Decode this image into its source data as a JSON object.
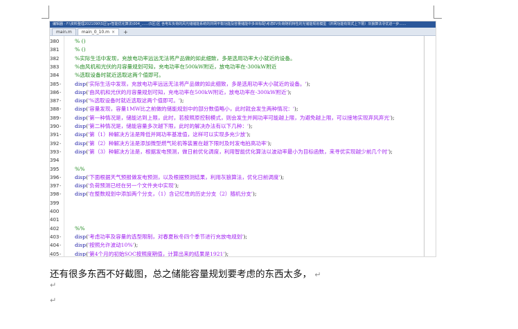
{
  "editor": {
    "title_bar": "编辑器 - F:\\资料整理2021090\\5区\\yr智能优化算法\\004_……(5区)区 含电车负荷的风光储储能系统的并网平衡功能及容量储能中多目标配\\考虑EV负荷随机特性的光储能规划模型（并网功能有效式上下限）灰狼算法寻优进一步……",
    "tabs": [
      {
        "label": "main.m",
        "active": false
      },
      {
        "label": "main_0_10.m",
        "active": true
      }
    ],
    "add_tab_label": "+",
    "close_glyph": "×",
    "lines": [
      {
        "num": "380",
        "dash": "",
        "kind": "cmt",
        "parts": [
          {
            "t": "% ()",
            "c": "cmt"
          }
        ]
      },
      {
        "num": "381",
        "dash": "",
        "kind": "cmt",
        "parts": [
          {
            "t": "% ()",
            "c": "cmt"
          }
        ]
      },
      {
        "num": "382",
        "dash": "",
        "kind": "cmt",
        "parts": [
          {
            "t": "%实际生活中发现，充放电功率远远无法将产品做的如此细致，多是选用功率大小就近的设备。",
            "c": "cmt"
          }
        ]
      },
      {
        "num": "383",
        "dash": "",
        "kind": "cmt",
        "parts": [
          {
            "t": "%由风机和光伏的月容量规划可知，充电功率在500kW附近，放电功率在-300kW附近",
            "c": "cmt"
          }
        ]
      },
      {
        "num": "384",
        "dash": "",
        "kind": "cmt",
        "parts": [
          {
            "t": "%选取设备时就近选取这两个值即可。",
            "c": "cmt"
          }
        ]
      },
      {
        "num": "385",
        "dash": "-",
        "kind": "code",
        "parts": [
          {
            "t": "disp",
            "c": "kw"
          },
          {
            "t": "(",
            "c": "plain"
          },
          {
            "t": "'实际生活中发现，充放电功率远远无法将产品做的如此细致，多是选用功率大小就近的设备。'",
            "c": "str"
          },
          {
            "t": ");",
            "c": "plain"
          }
        ]
      },
      {
        "num": "386",
        "dash": "-",
        "kind": "code",
        "parts": [
          {
            "t": "disp",
            "c": "kw"
          },
          {
            "t": "(",
            "c": "plain"
          },
          {
            "t": "'由风机和光伏的月容量规划可知，充电功率在500kW附近，放电功率在-300kW附近'",
            "c": "str"
          },
          {
            "t": ");",
            "c": "plain"
          }
        ]
      },
      {
        "num": "387",
        "dash": "-",
        "kind": "code",
        "parts": [
          {
            "t": "disp",
            "c": "kw"
          },
          {
            "t": "(",
            "c": "plain"
          },
          {
            "t": "'%选取设备时就近选取这两个值即可。'",
            "c": "str"
          },
          {
            "t": ");",
            "c": "plain"
          }
        ]
      },
      {
        "num": "388",
        "dash": "-",
        "kind": "code",
        "parts": [
          {
            "t": "disp",
            "c": "kw"
          },
          {
            "t": "(",
            "c": "plain"
          },
          {
            "t": "'容量发现，容量1MW比之前做的储能规划中的部分数值略小，此时就会发生两种情况：'",
            "c": "str"
          },
          {
            "t": ");",
            "c": "plain"
          }
        ]
      },
      {
        "num": "389",
        "dash": "-",
        "kind": "code",
        "parts": [
          {
            "t": "disp",
            "c": "kw"
          },
          {
            "t": "(",
            "c": "plain"
          },
          {
            "t": "'第一种情况是，储能达到上限，此时，若按照原控制模式，则会发生并网功率可能越上限，为避免越上限，可以接地实现弃风弃光'",
            "c": "str"
          },
          {
            "t": ");",
            "c": "plain"
          }
        ]
      },
      {
        "num": "390",
        "dash": "-",
        "kind": "code",
        "parts": [
          {
            "t": "disp",
            "c": "kw"
          },
          {
            "t": "(",
            "c": "plain"
          },
          {
            "t": "'第二种情况是，储能容量多次越下限，此时的解决办法有以下几种：'",
            "c": "str"
          },
          {
            "t": ");",
            "c": "plain"
          }
        ]
      },
      {
        "num": "391",
        "dash": "-",
        "kind": "code",
        "parts": [
          {
            "t": "disp",
            "c": "kw"
          },
          {
            "t": "(",
            "c": "plain"
          },
          {
            "t": "'第（1）种解决方法是降低并网功率基准值，这样可以实现多充少放'",
            "c": "str"
          },
          {
            "t": ");",
            "c": "plain"
          }
        ]
      },
      {
        "num": "392",
        "dash": "-",
        "kind": "code",
        "parts": [
          {
            "t": "disp",
            "c": "kw"
          },
          {
            "t": "(",
            "c": "plain"
          },
          {
            "t": "'第（2）种解决方法是添加微型燃气轮机等装置在越下限时及时发电拍高功率'",
            "c": "str"
          },
          {
            "t": ");",
            "c": "plain"
          }
        ]
      },
      {
        "num": "393",
        "dash": "-",
        "kind": "code",
        "parts": [
          {
            "t": "disp",
            "c": "kw"
          },
          {
            "t": "(",
            "c": "plain"
          },
          {
            "t": "'第（3）种解决方法是，根据发电预测，做日前优化调度，利用智能优化算法以波动率最小为目标函数，来寻优实现越少前几个时'",
            "c": "str"
          },
          {
            "t": ");",
            "c": "plain"
          }
        ]
      },
      {
        "num": "394",
        "dash": "",
        "kind": "blank",
        "parts": []
      },
      {
        "num": "395",
        "dash": "",
        "kind": "cmt",
        "parts": [
          {
            "t": "%%",
            "c": "cmt"
          }
        ]
      },
      {
        "num": "396",
        "dash": "-",
        "kind": "code",
        "parts": [
          {
            "t": "disp",
            "c": "kw"
          },
          {
            "t": "(",
            "c": "plain"
          },
          {
            "t": "'下面根据天气预报做发电预测，以及根据预测结果，利用灰狼算法，优化日前调度'",
            "c": "str"
          },
          {
            "t": ");",
            "c": "plain"
          }
        ]
      },
      {
        "num": "397",
        "dash": "-",
        "kind": "code",
        "parts": [
          {
            "t": "disp",
            "c": "kw"
          },
          {
            "t": "(",
            "c": "plain"
          },
          {
            "t": "'负荷预测已经在另一个文件夹中实现'",
            "c": "str"
          },
          {
            "t": ");",
            "c": "plain"
          }
        ]
      },
      {
        "num": "398",
        "dash": "-",
        "kind": "code",
        "parts": [
          {
            "t": "disp",
            "c": "kw"
          },
          {
            "t": "(",
            "c": "plain"
          },
          {
            "t": "'在整数规划中添加两个分支，（1）含记忆性的历史分支（2）随机分支'",
            "c": "str"
          },
          {
            "t": ");",
            "c": "plain"
          }
        ]
      },
      {
        "num": "399",
        "dash": "",
        "kind": "blank",
        "parts": []
      },
      {
        "num": "400",
        "dash": "",
        "kind": "blank",
        "parts": []
      },
      {
        "num": "401",
        "dash": "",
        "kind": "blank",
        "parts": []
      },
      {
        "num": "402",
        "dash": "",
        "kind": "cmt",
        "parts": [
          {
            "t": "%%",
            "c": "cmt"
          }
        ]
      },
      {
        "num": "403",
        "dash": "-",
        "kind": "code",
        "parts": [
          {
            "t": "disp",
            "c": "kw"
          },
          {
            "t": "(",
            "c": "plain"
          },
          {
            "t": "'考虑功率及容量的选型限制，对春夏秋冬四个季节进行充放电规划'",
            "c": "str"
          },
          {
            "t": ");",
            "c": "plain"
          }
        ]
      },
      {
        "num": "404",
        "dash": "-",
        "kind": "code",
        "parts": [
          {
            "t": "disp",
            "c": "kw"
          },
          {
            "t": "(",
            "c": "plain"
          },
          {
            "t": "'按照允许波动10%'",
            "c": "str"
          },
          {
            "t": ");",
            "c": "plain"
          }
        ]
      },
      {
        "num": "405",
        "dash": "-",
        "kind": "code",
        "parts": [
          {
            "t": "disp",
            "c": "kw"
          },
          {
            "t": "(",
            "c": "plain"
          },
          {
            "t": "'第4个月的初始SOC按照度期值，计算出来的结果是1921'",
            "c": "str"
          },
          {
            "t": ");",
            "c": "plain"
          }
        ]
      }
    ]
  },
  "document": {
    "paragraph": "还有很多东西不好截图，总之储能容量规划要考虑的东西太多，",
    "paragraph_mark": "↵",
    "empty_paragraphs": [
      "↵",
      "↵"
    ]
  },
  "colors": {
    "keyword": "#1a1aa6",
    "string": "#a020f0",
    "comment": "#228b22",
    "title_bar": "#2b579a"
  }
}
